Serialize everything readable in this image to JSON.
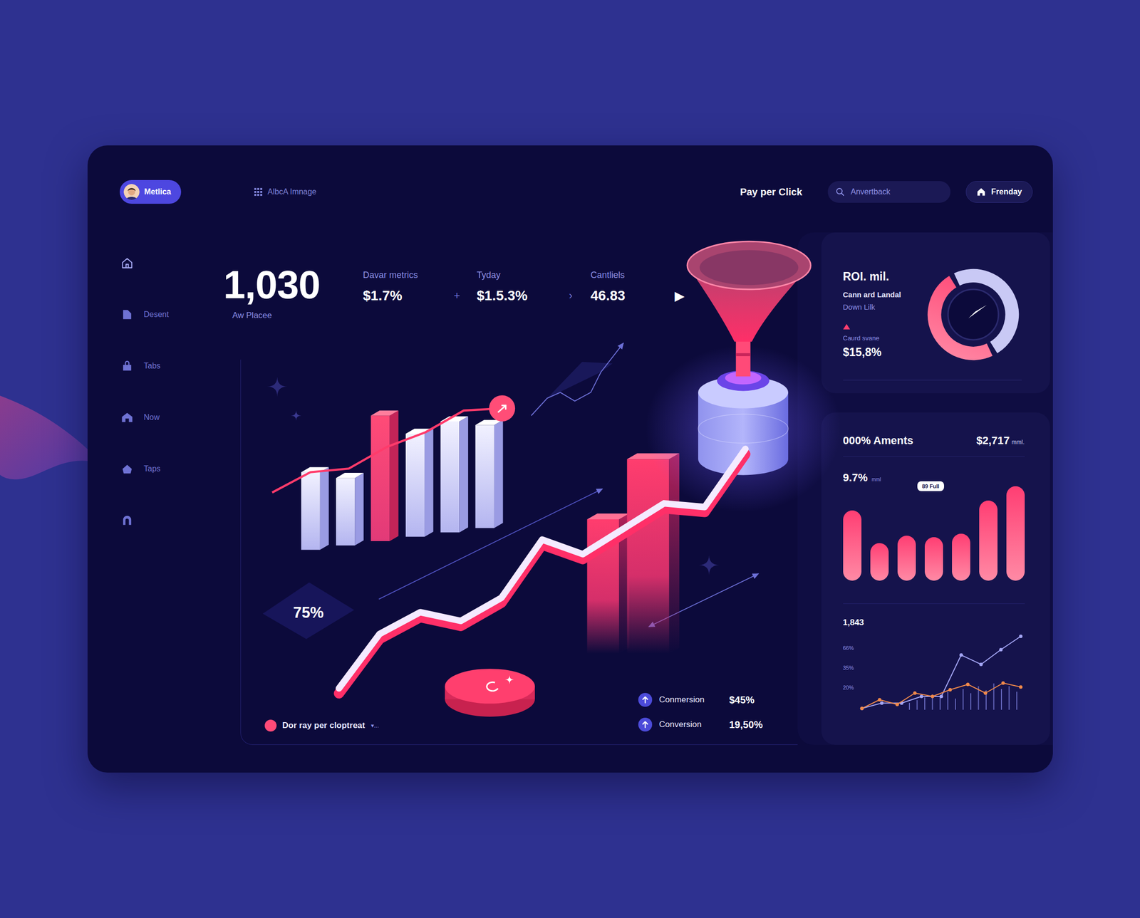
{
  "profile": {
    "name": "Metlica"
  },
  "workspace": {
    "label": "AlbcA Imnage"
  },
  "header": {
    "title": "Pay per Click",
    "search_placeholder": "Anvertback",
    "button": "Frenday"
  },
  "sidebar": {
    "items": [
      {
        "kind": "icon",
        "selected": true
      },
      {
        "kind": "labeled",
        "label": "Desent",
        "selected": false
      },
      {
        "kind": "labeled",
        "label": "Tabs",
        "selected": false
      },
      {
        "kind": "labeled",
        "label": "Now",
        "selected": false
      },
      {
        "kind": "labeled",
        "label": "Taps",
        "selected": false
      },
      {
        "kind": "icon",
        "selected": false
      }
    ]
  },
  "stats": {
    "headline": {
      "value": "1,030",
      "label": "Aw Placee"
    },
    "metrics": [
      {
        "label": "Davar metrics",
        "value": "$1.7%",
        "separator": "+"
      },
      {
        "label": "Tyday",
        "value": "$1.5.3%",
        "separator": "›"
      },
      {
        "label": "Cantliels",
        "value": "46.83",
        "separator": "▶"
      }
    ]
  },
  "main_chart": {
    "badge": "75%",
    "bars": [
      {
        "value": 107,
        "highlight": false
      },
      {
        "value": 93,
        "highlight": false
      },
      {
        "value": 173,
        "highlight": true
      },
      {
        "value": 142,
        "highlight": false
      },
      {
        "value": 153,
        "highlight": false
      },
      {
        "value": 142,
        "highlight": false
      }
    ],
    "trend": [
      82,
      110,
      115,
      145,
      165,
      195,
      198
    ],
    "ribbon": [
      25,
      100,
      130,
      118,
      150,
      230,
      210,
      245,
      280,
      275,
      355
    ],
    "towers": [
      185,
      268
    ],
    "legend": {
      "label": "Dor ray per cloptreat",
      "suffix": "▾..."
    },
    "conversions": [
      {
        "label": "Conmersion",
        "value": "$45%"
      },
      {
        "label": "Conversion",
        "value": "19,50%"
      }
    ]
  },
  "roi_card": {
    "title": "ROI. mil.",
    "subtitle": "Cann ard Landal",
    "link": "Down Lilk",
    "caption": "Caurd svane",
    "value": "$15,8%",
    "gauge": {
      "level": 0.5
    }
  },
  "amounts_card": {
    "title": "000% Aments",
    "total": "$2,717",
    "total_unit": "mml.",
    "rate": "9.7%",
    "rate_unit": "mml",
    "tooltip": "89 Full",
    "bars": [
      97,
      52,
      62,
      60,
      65,
      110,
      130
    ],
    "line_chart": {
      "title": "1,843",
      "ticks": [
        "66%",
        "35%",
        "20%"
      ],
      "series": [
        {
          "color": "#a4a6f5",
          "values": [
            2,
            10,
            10,
            20,
            20,
            82,
            68,
            90,
            110
          ]
        },
        {
          "color": "#f0894a",
          "values": [
            2,
            15,
            8,
            25,
            20,
            30,
            38,
            25,
            40,
            34
          ]
        }
      ],
      "spikes": [
        10,
        14,
        18,
        22,
        20,
        26,
        16,
        30,
        24,
        34,
        28,
        38,
        30,
        34,
        26
      ]
    }
  }
}
